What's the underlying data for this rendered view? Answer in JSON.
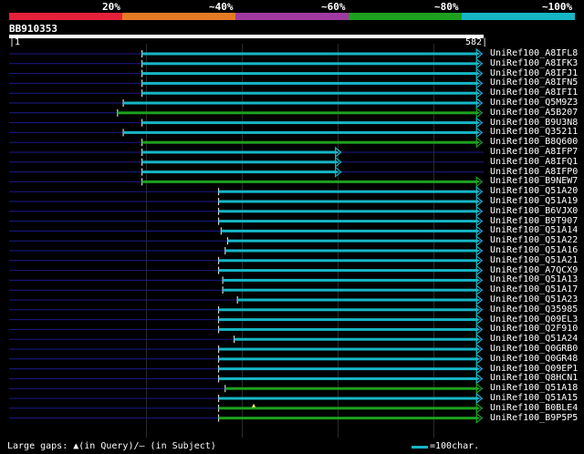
{
  "legend": {
    "labels": [
      "20%",
      "~40%",
      "~60%",
      "~80%",
      "~100%"
    ],
    "colors": [
      "#e5203b",
      "#e57a25",
      "#a03aa0",
      "#1ea01e",
      "#16b6c6"
    ]
  },
  "query": {
    "name": "BB910353",
    "start": "1",
    "end": "582",
    "length": 582
  },
  "colors": {
    "query_line": "#1a1a8c",
    "cyan": "#16b6c6",
    "green": "#1ea01e",
    "gap_marker": "#ffff66"
  },
  "hits": [
    {
      "name": "UniRef100_A8IFL8",
      "start": 163,
      "end": 580,
      "color": "cyan",
      "arrow": "right"
    },
    {
      "name": "UniRef100_A8IFK3",
      "start": 163,
      "end": 580,
      "color": "cyan",
      "arrow": "right"
    },
    {
      "name": "UniRef100_A8IFJ1",
      "start": 163,
      "end": 580,
      "color": "cyan",
      "arrow": "right"
    },
    {
      "name": "UniRef100_A8IFN5",
      "start": 163,
      "end": 580,
      "color": "cyan",
      "arrow": "right"
    },
    {
      "name": "UniRef100_A8IFI1",
      "start": 163,
      "end": 580,
      "color": "cyan",
      "arrow": "right"
    },
    {
      "name": "UniRef100_Q5M9Z3",
      "start": 140,
      "end": 580,
      "color": "cyan",
      "arrow": "right"
    },
    {
      "name": "UniRef100_A5B207",
      "start": 133,
      "end": 580,
      "color": "green",
      "arrow": "right"
    },
    {
      "name": "UniRef100_B9U3N8",
      "start": 163,
      "end": 580,
      "color": "cyan",
      "arrow": "right"
    },
    {
      "name": "UniRef100_Q35211",
      "start": 140,
      "end": 580,
      "color": "cyan",
      "arrow": "right"
    },
    {
      "name": "UniRef100_B8Q600",
      "start": 163,
      "end": 580,
      "color": "green",
      "arrow": "right"
    },
    {
      "name": "UniRef100_A8IFP7",
      "start": 163,
      "end": 407,
      "color": "cyan",
      "arrow": "both"
    },
    {
      "name": "UniRef100_A8IFQ1",
      "start": 163,
      "end": 407,
      "color": "cyan",
      "arrow": "both"
    },
    {
      "name": "UniRef100_A8IFP0",
      "start": 163,
      "end": 407,
      "color": "cyan",
      "arrow": "both"
    },
    {
      "name": "UniRef100_B9NEW7",
      "start": 163,
      "end": 580,
      "color": "green",
      "arrow": "right"
    },
    {
      "name": "UniRef100_Q51A20",
      "start": 257,
      "end": 580,
      "color": "cyan",
      "arrow": "right"
    },
    {
      "name": "UniRef100_Q51A19",
      "start": 257,
      "end": 580,
      "color": "cyan",
      "arrow": "right"
    },
    {
      "name": "UniRef100_B6VJX0",
      "start": 257,
      "end": 580,
      "color": "cyan",
      "arrow": "right"
    },
    {
      "name": "UniRef100_B9T907",
      "start": 257,
      "end": 580,
      "color": "cyan",
      "arrow": "right"
    },
    {
      "name": "UniRef100_Q51A14",
      "start": 260,
      "end": 580,
      "color": "cyan",
      "arrow": "right"
    },
    {
      "name": "UniRef100_Q51A22",
      "start": 268,
      "end": 580,
      "color": "cyan",
      "arrow": "right"
    },
    {
      "name": "UniRef100_Q51A16",
      "start": 265,
      "end": 580,
      "color": "cyan",
      "arrow": "right"
    },
    {
      "name": "UniRef100_Q51A21",
      "start": 257,
      "end": 580,
      "color": "cyan",
      "arrow": "right"
    },
    {
      "name": "UniRef100_A7QCX9",
      "start": 257,
      "end": 580,
      "color": "cyan",
      "arrow": "right"
    },
    {
      "name": "UniRef100_Q51A13",
      "start": 262,
      "end": 580,
      "color": "cyan",
      "arrow": "right"
    },
    {
      "name": "UniRef100_Q51A17",
      "start": 262,
      "end": 580,
      "color": "cyan",
      "arrow": "right"
    },
    {
      "name": "UniRef100_Q51A23",
      "start": 280,
      "end": 580,
      "color": "cyan",
      "arrow": "right"
    },
    {
      "name": "UniRef100_Q35985",
      "start": 257,
      "end": 580,
      "color": "cyan",
      "arrow": "right"
    },
    {
      "name": "UniRef100_Q09EL3",
      "start": 257,
      "end": 580,
      "color": "cyan",
      "arrow": "right"
    },
    {
      "name": "UniRef100_Q2F910",
      "start": 257,
      "end": 580,
      "color": "cyan",
      "arrow": "right"
    },
    {
      "name": "UniRef100_Q51A24",
      "start": 276,
      "end": 580,
      "color": "cyan",
      "arrow": "right"
    },
    {
      "name": "UniRef100_Q0GRB0",
      "start": 257,
      "end": 580,
      "color": "cyan",
      "arrow": "right"
    },
    {
      "name": "UniRef100_Q0GR48",
      "start": 257,
      "end": 580,
      "color": "cyan",
      "arrow": "right"
    },
    {
      "name": "UniRef100_Q09EP1",
      "start": 257,
      "end": 580,
      "color": "cyan",
      "arrow": "right"
    },
    {
      "name": "UniRef100_Q8HCN1",
      "start": 257,
      "end": 580,
      "color": "cyan",
      "arrow": "right"
    },
    {
      "name": "UniRef100_Q51A18",
      "start": 265,
      "end": 580,
      "color": "green",
      "arrow": "right"
    },
    {
      "name": "UniRef100_Q51A15",
      "start": 257,
      "end": 580,
      "color": "cyan",
      "arrow": "right"
    },
    {
      "name": "UniRef100_B0BLE4",
      "start": 257,
      "end": 580,
      "color": "green",
      "arrow": "right",
      "gap": 300
    },
    {
      "name": "UniRef100_B9P5P5",
      "start": 257,
      "end": 580,
      "color": "green",
      "arrow": "right"
    }
  ],
  "footer": {
    "gaps_text": "Large gaps: ▲(in Query)/— (in Subject)",
    "scale_text": "=100char."
  }
}
